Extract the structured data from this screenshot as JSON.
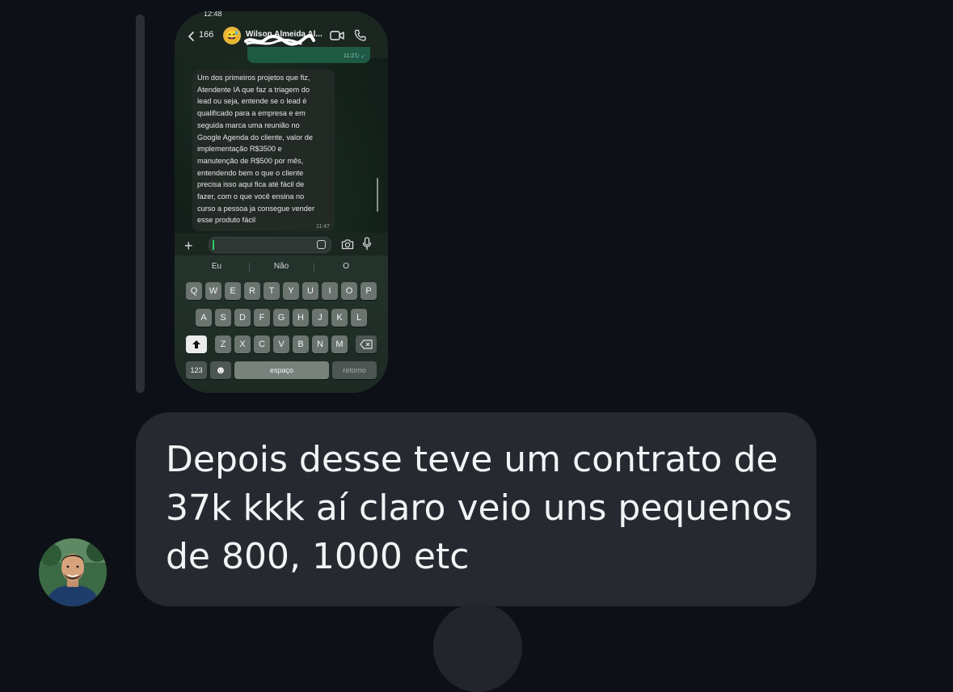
{
  "screenshot": {
    "status_time": "12:48",
    "header": {
      "back_count": "166",
      "contact_name": "Wilson Almeida Al...",
      "contact_emoji": "😅"
    },
    "sent_message": {
      "time": "11:27",
      "ticks": "✓✓"
    },
    "received_message": {
      "lines": [
        "Um dos primeiros projetos que fiz,",
        "Atendente IA que faz a triagem do",
        "lead ou seja, entende se o lead é",
        "qualificado para a empresa e em",
        "seguida marca uma reunião no",
        "Google Agenda do cliente, valor de",
        "implementação R$3500 e",
        "manutenção de R$500 por mês,",
        "entendendo bem o que o cliente",
        "precisa isso aqui fica até fácil de",
        "fazer, com o que você ensina no",
        "curso a pessoa ja consegue vender",
        "esse produto fácil"
      ],
      "time": "11:47"
    },
    "input": {
      "plus": "+",
      "value": ""
    },
    "keyboard": {
      "suggestions": [
        "Eu",
        "Não",
        "O"
      ],
      "row1": [
        "Q",
        "W",
        "E",
        "R",
        "T",
        "Y",
        "U",
        "I",
        "O",
        "P"
      ],
      "row2": [
        "A",
        "S",
        "D",
        "F",
        "G",
        "H",
        "J",
        "K",
        "L"
      ],
      "row3": [
        "Z",
        "X",
        "C",
        "V",
        "B",
        "N",
        "M"
      ],
      "numbers_key": "123",
      "emoji_key": "☻",
      "space_key": "espaço",
      "return_key": "retorno"
    }
  },
  "message": {
    "lines": [
      "Depois desse teve um contrato de",
      "37k kkk aí claro veio uns pequenos",
      "de 800, 1000 etc"
    ]
  },
  "colors": {
    "background": "#0d1117",
    "bubble": "#262a30",
    "whatsapp_green": "#25d366",
    "sent_bubble": "#1f5a44"
  }
}
